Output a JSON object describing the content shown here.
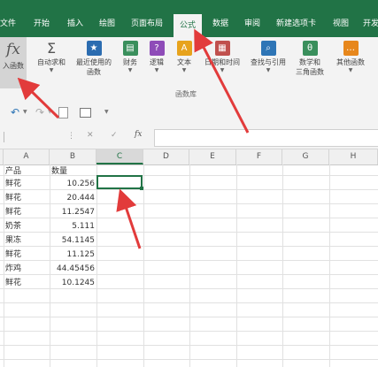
{
  "tabs": [
    {
      "label": "文件",
      "active": false
    },
    {
      "label": "开始",
      "active": false
    },
    {
      "label": "插入",
      "active": false
    },
    {
      "label": "绘图",
      "active": false
    },
    {
      "label": "页面布局",
      "active": false
    },
    {
      "label": "公式",
      "active": true
    },
    {
      "label": "数据",
      "active": false
    },
    {
      "label": "审阅",
      "active": false
    },
    {
      "label": "新建选项卡",
      "active": false
    },
    {
      "label": "视图",
      "active": false
    },
    {
      "label": "开发",
      "active": false
    }
  ],
  "ribbon": {
    "insert_function": {
      "icon": "fx",
      "label": "入函数"
    },
    "buttons": [
      {
        "icon": "Σ",
        "label": "自动求和",
        "label2": ""
      },
      {
        "icon": "★",
        "label": "最近使用的",
        "label2": "函数"
      },
      {
        "icon": "▤",
        "label": "财务",
        "label2": ""
      },
      {
        "icon": "?",
        "label": "逻辑",
        "label2": ""
      },
      {
        "icon": "A",
        "label": "文本",
        "label2": ""
      },
      {
        "icon": "▦",
        "label": "日期和时间",
        "label2": ""
      },
      {
        "icon": "⌕",
        "label": "查找与引用",
        "label2": ""
      },
      {
        "icon": "θ",
        "label": "数学和",
        "label2": "三角函数"
      },
      {
        "icon": "…",
        "label": "其他函数",
        "label2": ""
      }
    ],
    "group_label": "函数库"
  },
  "formula_bar": {
    "cancel": "✕",
    "enter": "✓",
    "fx": "fx",
    "value": ""
  },
  "columns": [
    "A",
    "B",
    "C",
    "D",
    "E",
    "F",
    "G",
    "H"
  ],
  "selected_column": "C",
  "header_row": {
    "a": "产品",
    "b": "数量"
  },
  "rows": [
    {
      "a": "鲜花",
      "b": "10.256"
    },
    {
      "a": "鲜花",
      "b": "20.444"
    },
    {
      "a": "鲜花",
      "b": "11.2547"
    },
    {
      "a": "奶茶",
      "b": "5.111"
    },
    {
      "a": "果冻",
      "b": "54.1145"
    },
    {
      "a": "鲜花",
      "b": "11.125"
    },
    {
      "a": "炸鸡",
      "b": "44.45456"
    },
    {
      "a": "鲜花",
      "b": "10.1245"
    }
  ],
  "colors": {
    "ribbon_green": "#217346",
    "arrow_red": "#e23b3b"
  }
}
